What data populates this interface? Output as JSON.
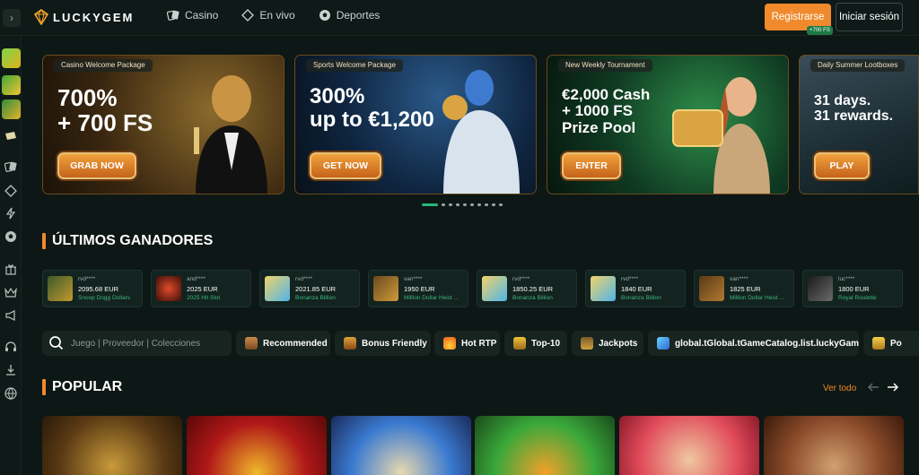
{
  "brand": {
    "name": "LUCKYGEM",
    "accent": "#f08a2c",
    "green": "#27b879"
  },
  "nav": [
    {
      "label": "Casino",
      "icon": "casino-cards-icon"
    },
    {
      "label": "En vivo",
      "icon": "live-icon"
    },
    {
      "label": "Deportes",
      "icon": "soccer-ball-icon"
    }
  ],
  "auth": {
    "register_label": "Registrarse",
    "register_badge": "+700 FS",
    "login_label": "Iniciar sesión"
  },
  "banners": [
    {
      "tag": "Casino Welcome Package",
      "headline": "700%\n+ 700 FS",
      "cta": "GRAB NOW"
    },
    {
      "tag": "Sports Welcome Package",
      "headline": "300%\nup to €1,200",
      "cta": "GET NOW"
    },
    {
      "tag": "New Weekly Tournament",
      "headline": "€2,000 Cash\n+ 1000 FS\nPrize Pool",
      "cta": "ENTER"
    },
    {
      "tag": "Daily Summer Lootboxes",
      "headline": "31 days.\n31 rewards.",
      "cta": "PLAY"
    }
  ],
  "carousel": {
    "active": 1,
    "count": 10
  },
  "winners_title": "ÚLTIMOS GANADORES",
  "winners": [
    {
      "user": "rvd****",
      "amount": "2095.68 EUR",
      "game": "Snoop Dogg Dollars"
    },
    {
      "user": "and****",
      "amount": "2025 EUR",
      "game": "2025 Hit Slot"
    },
    {
      "user": "rvd****",
      "amount": "2021.85 EUR",
      "game": "Bonanza Billion"
    },
    {
      "user": "van****",
      "amount": "1950 EUR",
      "game": "Million Dollar Heist ..."
    },
    {
      "user": "rvd****",
      "amount": "1850.25 EUR",
      "game": "Bonanza Billion"
    },
    {
      "user": "rvd****",
      "amount": "1840 EUR",
      "game": "Bonanza Billion"
    },
    {
      "user": "van****",
      "amount": "1825 EUR",
      "game": "Million Dollar Heist ..."
    },
    {
      "user": "luc****",
      "amount": "1800 EUR",
      "game": "Royal Roulette"
    }
  ],
  "search": {
    "placeholder": "Juego | Proveedor | Colecciones"
  },
  "filters": [
    {
      "label": "Recommended",
      "icon": "recommended-icon"
    },
    {
      "label": "Bonus Friendly",
      "icon": "bonus-chest-icon"
    },
    {
      "label": "Hot RTP",
      "icon": "fire-icon"
    },
    {
      "label": "Top-10",
      "icon": "top10-icon"
    },
    {
      "label": "Jackpots",
      "icon": "jackpot-icon"
    },
    {
      "label": "global.tGlobal.tGameCatalog.list.luckyGames",
      "icon": "diamond-icon"
    },
    {
      "label": "Po",
      "icon": "trophy-icon"
    }
  ],
  "popular": {
    "title": "POPULAR",
    "see_all": "Ver todo"
  }
}
